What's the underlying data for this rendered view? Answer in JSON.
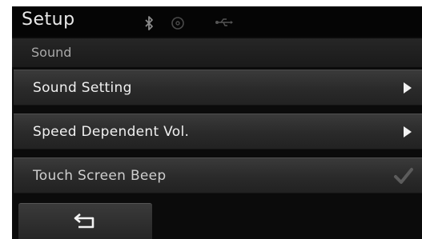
{
  "header": {
    "title": "Setup",
    "status_icons": [
      "bluetooth-icon",
      "disc-icon",
      "usb-icon"
    ]
  },
  "subheader": {
    "label": "Sound"
  },
  "menu": {
    "items": [
      {
        "label": "Sound Setting",
        "control": "arrow-right-icon"
      },
      {
        "label": "Speed Dependent Vol.",
        "control": "arrow-right-icon"
      },
      {
        "label": "Touch Screen Beep",
        "control": "checkmark-icon",
        "checked": true
      }
    ]
  },
  "footer": {
    "back_icon": "back-arrow-icon"
  },
  "colors": {
    "background": "#0b0b0b",
    "row": "#2e2e2e",
    "text": "#f0f0f0",
    "subtext": "#a9a9a9"
  }
}
